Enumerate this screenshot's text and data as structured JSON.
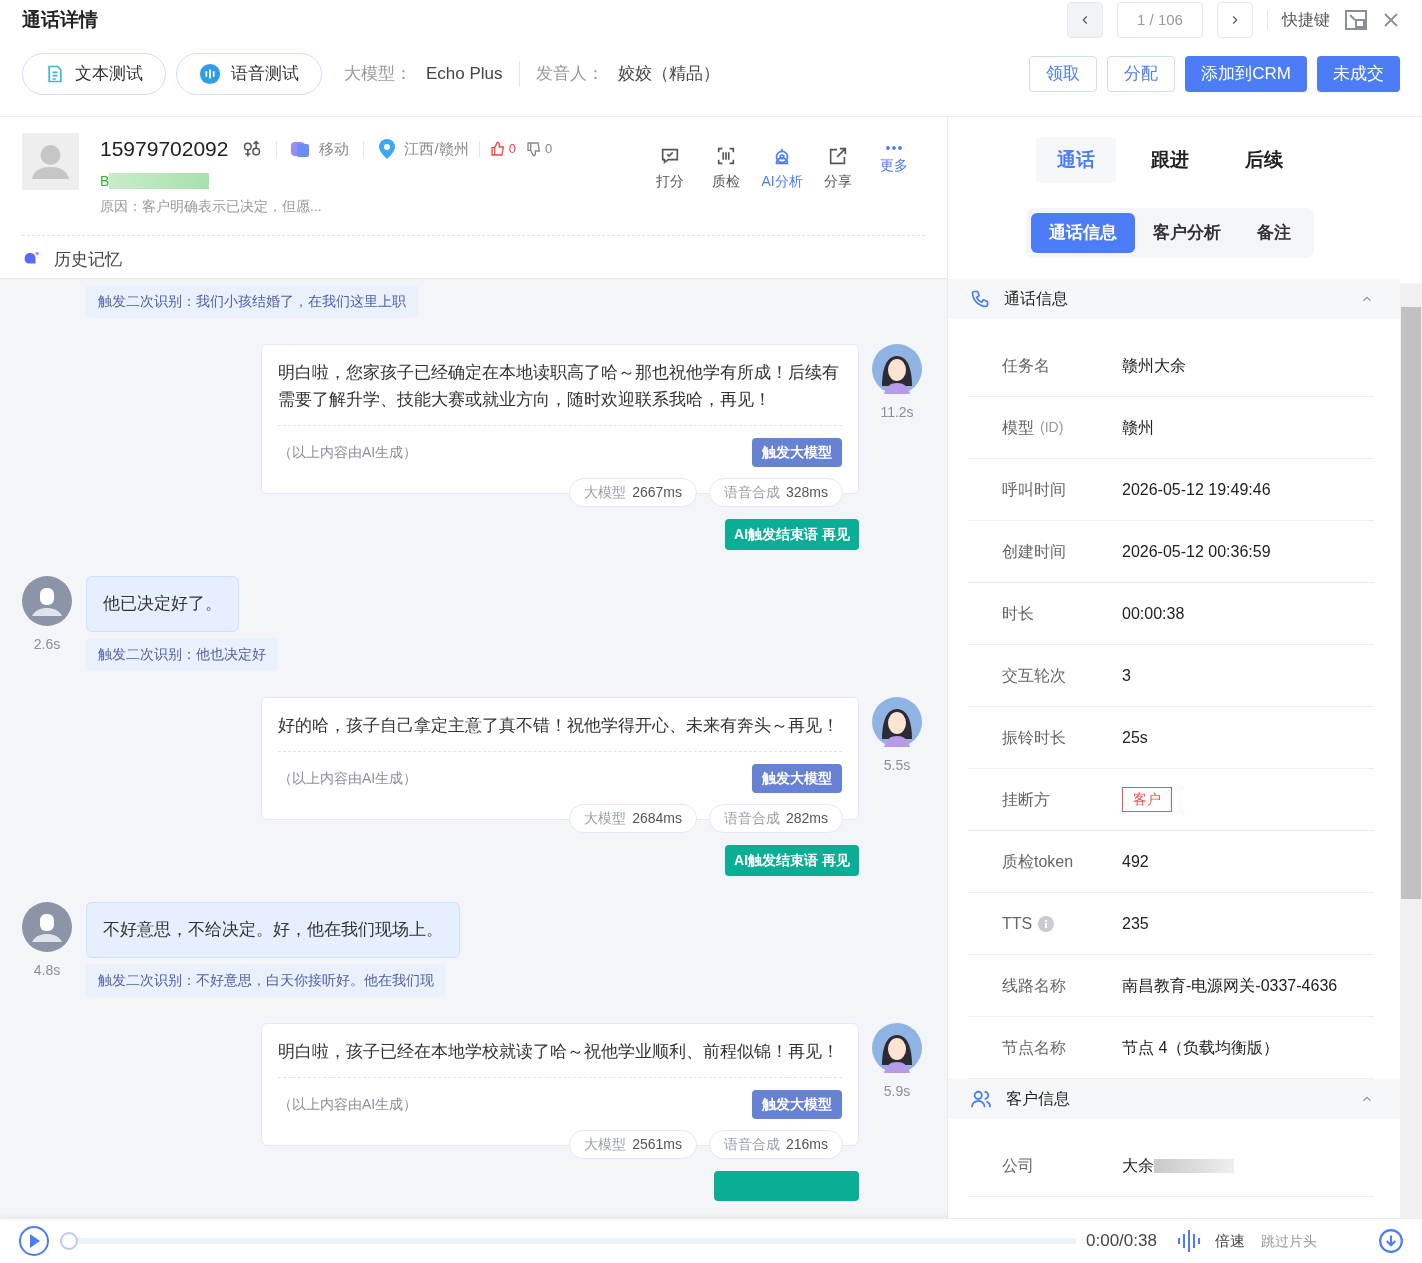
{
  "header": {
    "title": "通话详情",
    "pager": "1 / 106",
    "shortcut": "快捷键"
  },
  "test_buttons": [
    {
      "label": "文本测试",
      "kind": "text"
    },
    {
      "label": "语音测试",
      "kind": "voice"
    }
  ],
  "meta": [
    {
      "label": "大模型：",
      "value": "Echo Plus"
    },
    {
      "label": "发音人：",
      "value": "姣姣（精品）"
    }
  ],
  "actions": [
    {
      "label": "领取",
      "kind": "outline"
    },
    {
      "label": "分配",
      "kind": "outline"
    },
    {
      "label": "添加到CRM",
      "kind": "primary"
    },
    {
      "label": "未成交",
      "kind": "primary"
    }
  ],
  "contact": {
    "phone": "15979702092",
    "carrier": "移动",
    "region": "江西/赣州",
    "likes": "0",
    "dislikes": "0",
    "grade": "B",
    "reason": "原因：客户明确表示已决定，但愿..."
  },
  "tools": [
    {
      "label": "打分",
      "kind": "score",
      "highlighted": false
    },
    {
      "label": "质检",
      "kind": "scan",
      "highlighted": false
    },
    {
      "label": "AI分析",
      "kind": "ai",
      "highlighted": true
    },
    {
      "label": "分享",
      "kind": "share",
      "highlighted": false
    },
    {
      "label": "更多",
      "kind": "more",
      "highlighted": true
    }
  ],
  "history": "历史记忆",
  "chat": [
    {
      "kind": "recognition",
      "text": "触发二次识别：我们小孩结婚了，在我们这里上职"
    },
    {
      "kind": "bot",
      "text": "明白啦，您家孩子已经确定在本地读职高了哈～那也祝他学有所成！后续有需要了解升学、技能大赛或就业方向，随时欢迎联系我哈，再见！",
      "note": "（以上内容由AI生成）",
      "trigger": "触发大模型",
      "stats": [
        {
          "label": "大模型",
          "value": "2667ms"
        },
        {
          "label": "语音合成",
          "value": "328ms"
        }
      ],
      "time": "11.2s",
      "end_tag": "AI触发结束语 再见"
    },
    {
      "kind": "user",
      "text": "他已决定好了。",
      "time": "2.6s"
    },
    {
      "kind": "recognition",
      "text": "触发二次识别：他也决定好"
    },
    {
      "kind": "bot",
      "text": "好的哈，孩子自己拿定主意了真不错！祝他学得开心、未来有奔头～再见！",
      "note": "（以上内容由AI生成）",
      "trigger": "触发大模型",
      "stats": [
        {
          "label": "大模型",
          "value": "2684ms"
        },
        {
          "label": "语音合成",
          "value": "282ms"
        }
      ],
      "time": "5.5s",
      "end_tag": "AI触发结束语 再见"
    },
    {
      "kind": "user",
      "text": "不好意思，不给决定。好，他在我们现场上。",
      "time": "4.8s"
    },
    {
      "kind": "recognition",
      "text": "触发二次识别：不好意思，白天你接听好。他在我们现"
    },
    {
      "kind": "bot",
      "text": "明白啦，孩子已经在本地学校就读了哈～祝他学业顺利、前程似锦！再见！",
      "note": "（以上内容由AI生成）",
      "trigger": "触发大模型",
      "stats": [
        {
          "label": "大模型",
          "value": "2561ms"
        },
        {
          "label": "语音合成",
          "value": "216ms"
        }
      ],
      "time": "5.9s"
    }
  ],
  "right_tabs": [
    {
      "label": "通话",
      "selected": true
    },
    {
      "label": "跟进",
      "selected": false
    },
    {
      "label": "后续",
      "selected": false
    }
  ],
  "sub_tabs": [
    {
      "label": "通话信息",
      "selected": true
    },
    {
      "label": "客户分析",
      "selected": false
    },
    {
      "label": "备注",
      "selected": false
    }
  ],
  "call_info": {
    "title": "通话信息",
    "expanded": true,
    "rows": [
      {
        "label": "任务名",
        "value": "赣州大余"
      },
      {
        "label": "模型",
        "hint": "(ID)",
        "value": "赣州"
      },
      {
        "label": "呼叫时间",
        "value": "2026-05-12 19:49:46"
      },
      {
        "label": "创建时间",
        "value": "2026-05-12 00:36:59"
      },
      {
        "label": "时长",
        "value": "00:00:38"
      },
      {
        "label": "交互轮次",
        "value": "3"
      },
      {
        "label": "振铃时长",
        "value": "25s"
      },
      {
        "label": "挂断方",
        "value": "客户",
        "kind": "tag"
      },
      {
        "label": "质检token",
        "value": "492"
      },
      {
        "label": "TTS",
        "value": "235",
        "info": true
      },
      {
        "label": "线路名称",
        "value": "南昌教育-电源网关-0337-4636"
      },
      {
        "label": "节点名称",
        "value": "节点 4（负载均衡版）"
      }
    ]
  },
  "customer_info": {
    "title": "客户信息",
    "expanded": true,
    "rows": [
      {
        "label": "公司",
        "value": "大余",
        "blurred": true
      }
    ]
  },
  "player": {
    "time": "0:00/0:38",
    "level": 0,
    "speed": "倍速",
    "skip": "跳过片头"
  }
}
